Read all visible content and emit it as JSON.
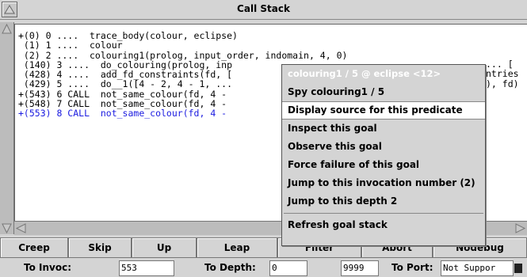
{
  "window": {
    "title": "Call Stack"
  },
  "stack_lines": [
    {
      "text": "+(0) 0 ....  trace_body(colour, eclipse)",
      "color": "black"
    },
    {
      "text": " (1) 1 ....  colour",
      "color": "black"
    },
    {
      "text": " (2) 2 ....  colouring1(prolog, input_order, indomain, 4, 0)",
      "color": "black"
    },
    {
      "text": " (140) 3 ....  do_colouring(prolog, inp",
      "color": "black"
    },
    {
      "text": " (428) 4 ....  add_fd_constraints(fd, [",
      "color": "black"
    },
    {
      "text": " (429) 5 ....  do__1([4 - 2, 4 - 1, ...",
      "color": "black"
    },
    {
      "text": "+(543) 6 CALL  not_same_colour(fd, 4 -",
      "color": "black"
    },
    {
      "text": "+(548) 7 CALL  not_same_colour(fd, 4 -",
      "color": "black"
    },
    {
      "text": "+(553) 8 CALL  not_same_colour(fd, 4 -",
      "color": "blue"
    }
  ],
  "stack_tails": [
    {
      "text": "... [",
      "row": 3
    },
    {
      "text": "ntries",
      "row": 4
    },
    {
      "text": "), fd)",
      "row": 5
    }
  ],
  "buttons": [
    "Creep",
    "Skip",
    "Up",
    "Leap",
    "Filter",
    "Abort",
    "Nodebug"
  ],
  "controls": {
    "to_invoc_label": "To Invoc:",
    "to_invoc_value": "553",
    "to_depth_label": "To Depth:",
    "to_depth_min": "0",
    "to_depth_max": "9999",
    "to_port_label": "To Port:",
    "to_port_value": "Not Suppor"
  },
  "context_menu": {
    "header": "colouring1 / 5 @ eclipse <12>",
    "items": [
      "Spy colouring1 / 5",
      "Display source for this predicate",
      "Inspect this goal",
      "Observe this goal",
      "Force failure of this goal",
      "Jump to this invocation number (2)",
      "Jump to this depth 2",
      "Refresh goal stack"
    ],
    "selected_index": 1
  },
  "colors": {
    "blue_line": "#1a1ae0",
    "menu_header": "#ffffff"
  }
}
